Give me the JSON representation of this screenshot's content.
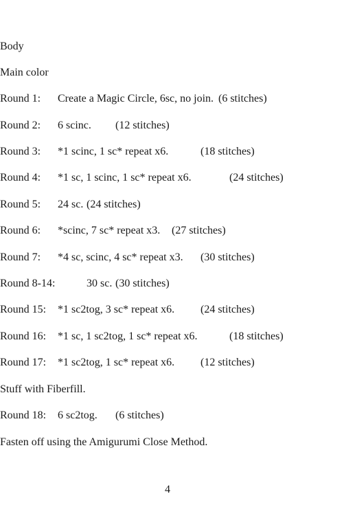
{
  "document": {
    "section_title": "Body",
    "subtitle": "Main color",
    "rounds": [
      {
        "label": "Round 1:",
        "instruction": "Create a Magic Circle, 6sc, no join.",
        "count": "(6 stitches)"
      },
      {
        "label": "Round 2:",
        "instruction": "6 scinc.",
        "count": "(12 stitches)"
      },
      {
        "label": "Round 3:",
        "instruction": "*1 scinc, 1 sc* repeat x6.",
        "count": "(18 stitches)"
      },
      {
        "label": "Round 4:",
        "instruction": "*1 sc, 1 scinc, 1 sc* repeat x6.",
        "count": "(24 stitches)"
      },
      {
        "label": "Round 5:",
        "instruction": "24 sc.",
        "count": "(24 stitches)"
      },
      {
        "label": "Round 6:",
        "instruction": "*scinc, 7 sc* repeat x3.",
        "count": "(27 stitches)"
      },
      {
        "label": "Round 7:",
        "instruction": "*4 sc, scinc, 4 sc* repeat x3.",
        "count": "(30 stitches)"
      },
      {
        "label": "Round 8-14:",
        "instruction": "30 sc.",
        "count": "(30 stitches)"
      },
      {
        "label": "Round 15:",
        "instruction": "*1 sc2tog, 3 sc* repeat x6.",
        "count": "(24 stitches)"
      },
      {
        "label": "Round 16:",
        "instruction": "*1 sc, 1 sc2tog, 1 sc* repeat x6.",
        "count": "(18 stitches)"
      },
      {
        "label": "Round 17:",
        "instruction": "*1 sc2tog, 1 sc* repeat x6.",
        "count": "(12 stitches)"
      }
    ],
    "note_stuff": "Stuff with Fiberfill.",
    "round_18": {
      "label": "Round 18:",
      "instruction": "6 sc2tog.",
      "count": "(6 stitches)"
    },
    "closing": "Fasten off using the Amigurumi Close Method.",
    "page_number": "4"
  }
}
